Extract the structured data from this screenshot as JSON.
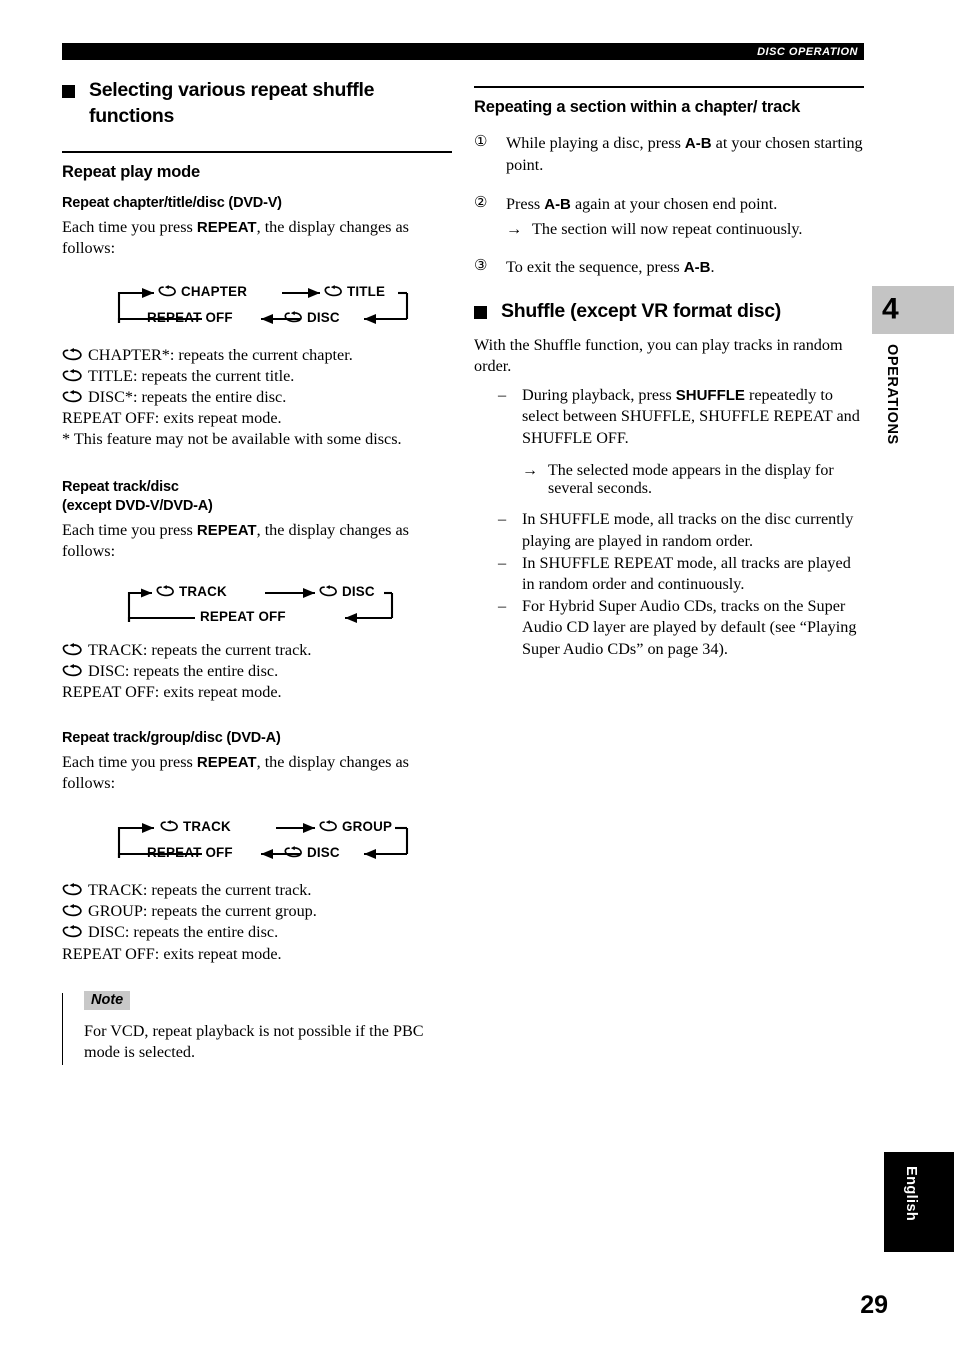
{
  "header": {
    "running_head": "DISC OPERATION"
  },
  "left_column": {
    "section_title": "Selecting various repeat shuffle functions",
    "h2_repeat_play_mode": "Repeat play mode",
    "sub1": {
      "heading": "Repeat chapter/title/disc (DVD-V)",
      "intro_pre": "Each time you press ",
      "intro_bold": "REPEAT",
      "intro_post": ", the display changes as follows:",
      "diagram": {
        "top_left": "CHAPTER",
        "top_right": "TITLE",
        "bottom_right": "DISC",
        "bottom_left": "REPEAT OFF"
      },
      "defs": [
        {
          "icon": "repeat-loop-icon",
          "text": "CHAPTER*: repeats the current chapter."
        },
        {
          "icon": "repeat-loop-icon",
          "text": "TITLE: repeats the current title."
        },
        {
          "icon": "repeat-loop-icon",
          "text": "DISC*: repeats the entire disc."
        }
      ],
      "def_off": "REPEAT OFF: exits repeat mode.",
      "footnote": "* This feature may not be available with some discs."
    },
    "sub2": {
      "heading_line1": "Repeat track/disc",
      "heading_line2": "(except DVD-V/DVD-A)",
      "intro_pre": "Each time you press ",
      "intro_bold": "REPEAT",
      "intro_post": ", the display changes as follows:",
      "diagram": {
        "top_left": "TRACK",
        "top_right": "DISC",
        "bottom": "REPEAT OFF"
      },
      "defs": [
        {
          "icon": "repeat-loop-icon",
          "text": "TRACK: repeats the current track."
        },
        {
          "icon": "repeat-loop-icon",
          "text": "DISC: repeats the entire disc."
        }
      ],
      "def_off": "REPEAT OFF: exits repeat mode."
    },
    "sub3": {
      "heading": "Repeat track/group/disc (DVD-A)",
      "intro_pre": "Each time you press ",
      "intro_bold": "REPEAT",
      "intro_post": ", the display changes as follows:",
      "diagram": {
        "top_left": "TRACK",
        "top_right": "GROUP",
        "bottom_right": "DISC",
        "bottom_left": "REPEAT OFF"
      },
      "defs": [
        {
          "icon": "repeat-loop-icon",
          "text": "TRACK: repeats the current track."
        },
        {
          "icon": "repeat-loop-icon",
          "text": "GROUP: repeats the current group."
        },
        {
          "icon": "repeat-loop-icon",
          "text": "DISC: repeats the entire disc."
        }
      ],
      "def_off": "REPEAT OFF: exits repeat mode."
    },
    "note": {
      "tag": "Note",
      "body": "For VCD, repeat playback is not possible if the PBC mode is selected."
    }
  },
  "right_column": {
    "h2_repeating_section": "Repeating a section within a chapter/ track",
    "steps": [
      {
        "num": "①",
        "pre": "While playing a disc, press ",
        "bold": "A-B",
        "post": " at your chosen starting point."
      },
      {
        "num": "②",
        "pre": "Press ",
        "bold": "A-B",
        "post": " again at your chosen end point.",
        "arrow": "→",
        "arrow_text": "The section will now repeat continuously."
      },
      {
        "num": "③",
        "pre": "To exit the sequence, press ",
        "bold": "A-B",
        "post": "."
      }
    ],
    "shuffle_title": "Shuffle (except VR format disc)",
    "shuffle_intro": "With the Shuffle function, you can play tracks in random order.",
    "shuffle_items": [
      {
        "dash": "–",
        "pre": "During playback, press ",
        "bold": "SHUFFLE",
        "post": " repeatedly to select between SHUFFLE, SHUFFLE REPEAT and SHUFFLE OFF.",
        "arrow": "→",
        "arrow_text": "The selected mode appears in the display for several seconds."
      },
      {
        "dash": "–",
        "pre": "",
        "bold": "",
        "post": "In SHUFFLE mode, all tracks on the disc currently playing are played in random order."
      },
      {
        "dash": "–",
        "pre": "",
        "bold": "",
        "post": "In SHUFFLE REPEAT mode, all tracks are played in random order and continuously."
      },
      {
        "dash": "–",
        "pre": "",
        "bold": "",
        "post": "For Hybrid Super Audio CDs, tracks on the Super Audio CD layer are played by default (see “Playing Super Audio CDs” on page 34)."
      }
    ]
  },
  "margin": {
    "chapter_number": "4",
    "chapter_label": "OPERATIONS",
    "language_tab": "English"
  },
  "footer": {
    "page_number": "29"
  },
  "colors": {
    "header_bar": "#000000",
    "note_tag_bg": "#c8c8c8",
    "chapter_tab_bg": "#c4c4c4",
    "lang_tab_bg": "#000000"
  }
}
